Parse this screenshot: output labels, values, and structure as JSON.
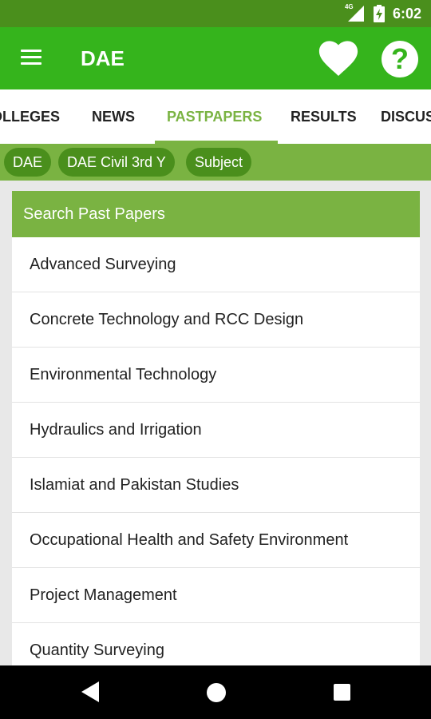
{
  "status_bar": {
    "network": "4G",
    "time": "6:02"
  },
  "app_bar": {
    "title": "DAE"
  },
  "tabs": [
    {
      "label": "COLLEGES"
    },
    {
      "label": "NEWS"
    },
    {
      "label": "PASTPAPERS"
    },
    {
      "label": "RESULTS"
    },
    {
      "label": "DISCUSSION"
    }
  ],
  "breadcrumbs": [
    {
      "label": "DAE"
    },
    {
      "label": "DAE Civil 3rd Y"
    },
    {
      "label": "Subject"
    }
  ],
  "card": {
    "header": "Search Past Papers",
    "items": [
      "Advanced Surveying",
      "Concrete Technology and RCC Design",
      "Environmental Technology",
      "Hydraulics and Irrigation",
      "Islamiat and Pakistan Studies",
      "Occupational Health and Safety Environment",
      "Project Management",
      "Quantity Surveying"
    ]
  }
}
